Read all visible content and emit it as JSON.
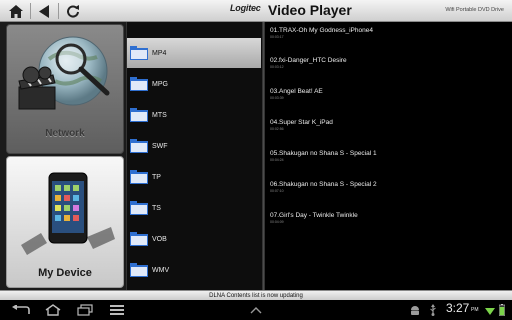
{
  "header": {
    "brand": "Logitec",
    "title": "Video Player",
    "subtitle": "Wifi Portable DVD Drive"
  },
  "sources": [
    {
      "label": "Network",
      "icon": "network-globe-icon",
      "selected": true
    },
    {
      "label": "My Device",
      "icon": "smartphone-icon",
      "selected": false
    }
  ],
  "folders": [
    {
      "label": "MP4",
      "selected": true
    },
    {
      "label": "MPG",
      "selected": false
    },
    {
      "label": "MTS",
      "selected": false
    },
    {
      "label": "SWF",
      "selected": false
    },
    {
      "label": "TP",
      "selected": false
    },
    {
      "label": "TS",
      "selected": false
    },
    {
      "label": "VOB",
      "selected": false
    },
    {
      "label": "WMV",
      "selected": false
    }
  ],
  "files": [
    {
      "name": "01.TRAX-Oh My Godness_iPhone4",
      "duration": "00:03:17"
    },
    {
      "name": "02.fxi-Danger_HTC Desire",
      "duration": "00:03:12"
    },
    {
      "name": "03.Angel Beat! AE",
      "duration": "00:03:39"
    },
    {
      "name": "04.Super Star K_iPad",
      "duration": "00:02:56"
    },
    {
      "name": "05.Shakugan no Shana S - Special 1",
      "duration": "00:04:24"
    },
    {
      "name": "06.Shakugan no Shana S - Special 2",
      "duration": "00:07:10"
    },
    {
      "name": "07.Girl's Day - Twinkle Twinkle",
      "duration": "00:04:09"
    }
  ],
  "status": "DLNA Contents list is now updating",
  "system": {
    "time": "3:27",
    "ampm": "PM"
  },
  "colors": {
    "folder_blue": "#2f6fd0",
    "selected_row": "#c0c0c0",
    "text_light": "#ececec"
  }
}
